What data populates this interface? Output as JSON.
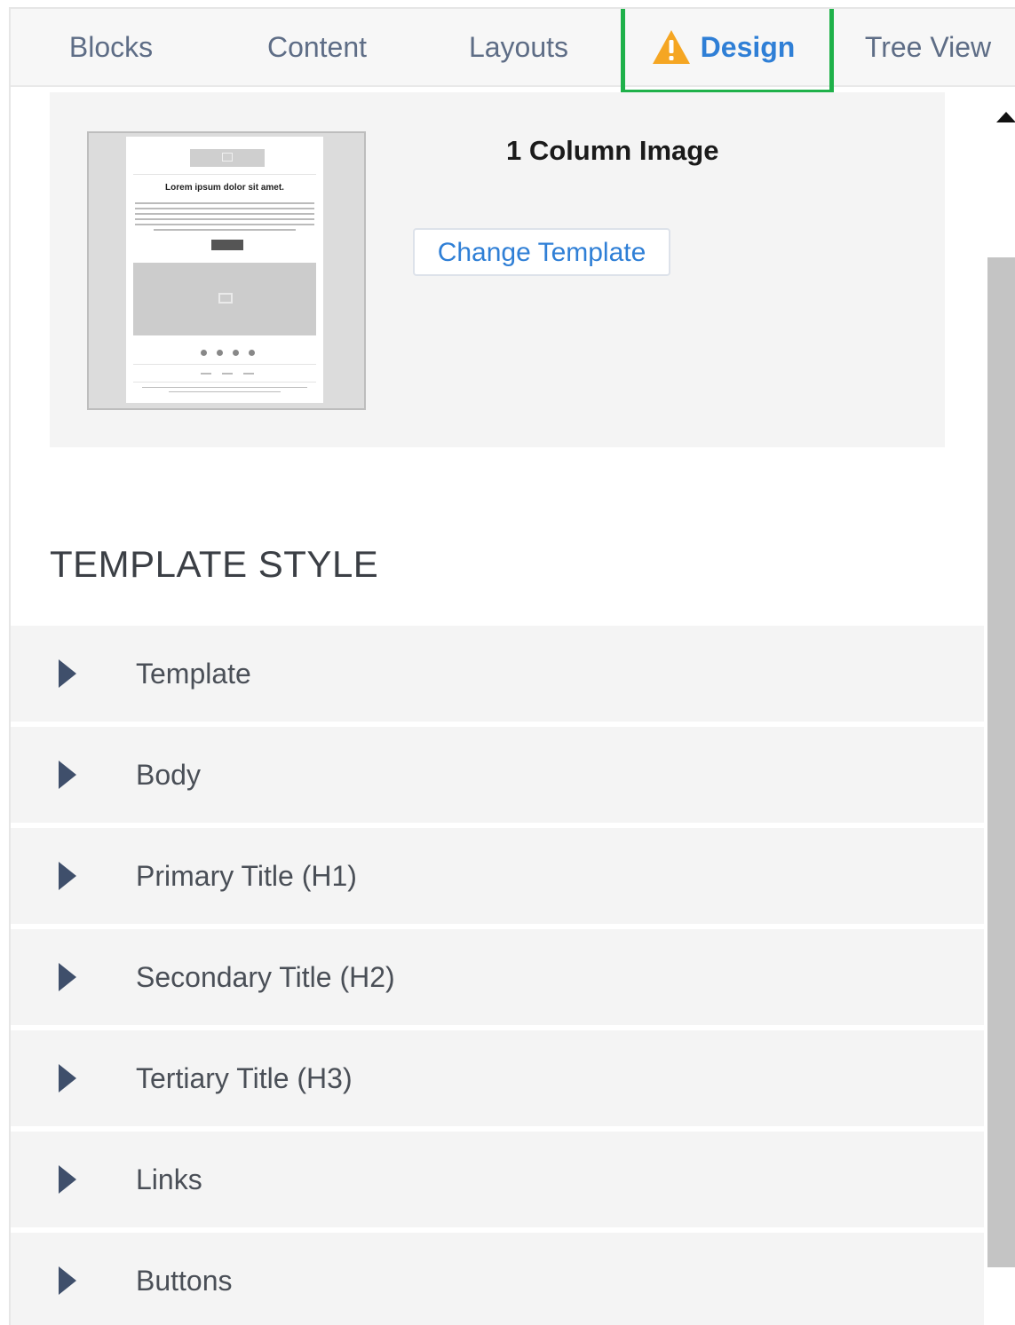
{
  "tabs": [
    {
      "label": "Blocks"
    },
    {
      "label": "Content"
    },
    {
      "label": "Layouts"
    },
    {
      "label": "Design",
      "active": true,
      "icon": "warning-triangle-icon"
    },
    {
      "label": "Tree View"
    }
  ],
  "template_card": {
    "title": "1 Column Image",
    "change_button": "Change Template",
    "thumbnail": {
      "heading": "Lorem ipsum dolor sit amet."
    }
  },
  "template_style": {
    "heading": "TEMPLATE STYLE",
    "items": [
      {
        "label": "Template"
      },
      {
        "label": "Body"
      },
      {
        "label": "Primary Title (H1)"
      },
      {
        "label": "Secondary Title (H2)"
      },
      {
        "label": "Tertiary Title (H3)"
      },
      {
        "label": "Links"
      },
      {
        "label": "Buttons"
      }
    ]
  },
  "colors": {
    "accent_blue": "#2f7fd6",
    "highlight_green": "#1fb14a",
    "warning_orange": "#f5a623",
    "arrow_navy": "#3f4f6b"
  }
}
